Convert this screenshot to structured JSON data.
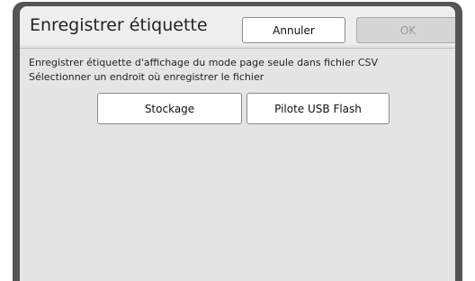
{
  "dialog": {
    "title": "Enregistrer étiquette",
    "cancel_label": "Annuler",
    "ok_label": "OK",
    "description_line1": "Enregistrer étiquette d'affichage du mode page seule dans fichier CSV",
    "description_line2": "Sélectionner un endroit où enregistrer le fichier",
    "options": {
      "storage_label": "Stockage",
      "usb_label": "Pilote USB Flash"
    }
  },
  "colors": {
    "frame": "#555555",
    "panel": "#e5e5e5",
    "button": "#ffffff",
    "disabled_button": "#d6d6d6"
  }
}
